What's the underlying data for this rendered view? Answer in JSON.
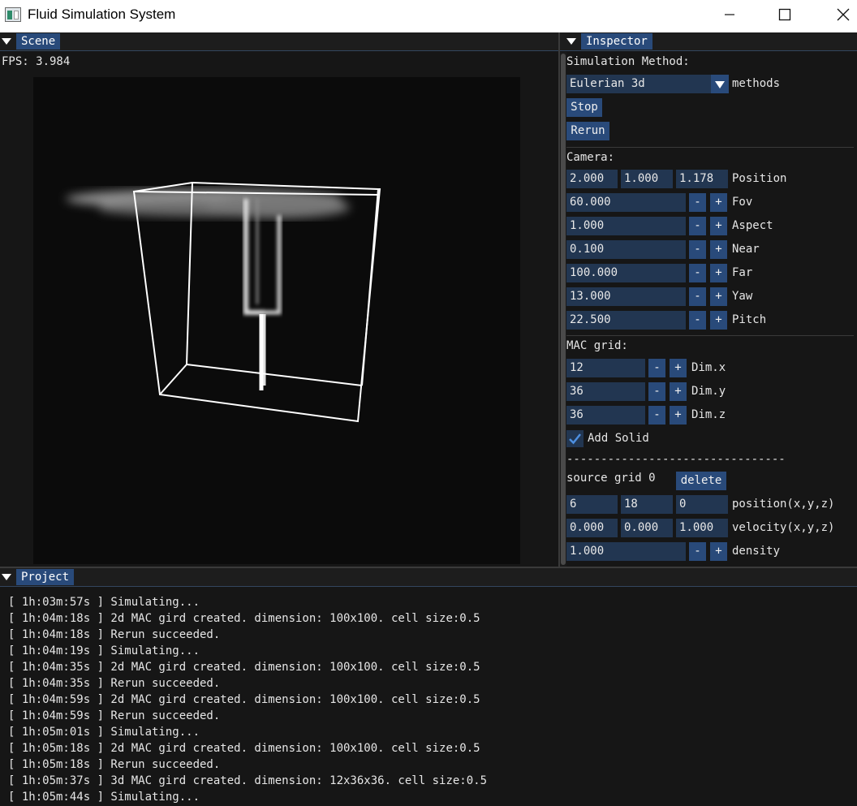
{
  "window": {
    "title": "Fluid Simulation System"
  },
  "scene": {
    "tab_label": "Scene",
    "fps": "FPS: 3.984"
  },
  "inspector": {
    "tab_label": "Inspector",
    "sim_method_label": "Simulation Method:",
    "method_value": "Eulerian 3d",
    "method_suffix": "methods",
    "stop_label": "Stop",
    "rerun_label": "Rerun",
    "camera_label": "Camera:",
    "camera_position": [
      "2.000",
      "1.000",
      "1.178"
    ],
    "position_label": "Position",
    "camera_rows": [
      {
        "value": "60.000",
        "label": "Fov"
      },
      {
        "value": "1.000",
        "label": "Aspect"
      },
      {
        "value": "0.100",
        "label": "Near"
      },
      {
        "value": "100.000",
        "label": "Far"
      },
      {
        "value": "13.000",
        "label": "Yaw"
      },
      {
        "value": "22.500",
        "label": "Pitch"
      }
    ],
    "mac_label": "MAC grid:",
    "mac_rows": [
      {
        "value": "12",
        "label": "Dim.x"
      },
      {
        "value": "36",
        "label": "Dim.y"
      },
      {
        "value": "36",
        "label": "Dim.z"
      }
    ],
    "add_solid_label": "Add Solid",
    "add_solid_checked": true,
    "dash_line": "--------------------------------",
    "source_grid_label": "source grid 0",
    "delete_label": "delete",
    "source_position": [
      "6",
      "18",
      "0"
    ],
    "source_position_label": "position(x,y,z)",
    "source_velocity": [
      "0.000",
      "0.000",
      "1.000"
    ],
    "source_velocity_label": "velocity(x,y,z)",
    "density_value": "1.000",
    "density_label": "density",
    "minus": "-",
    "plus": "+"
  },
  "project": {
    "tab_label": "Project",
    "log": [
      "[ 1h:03m:57s ] Simulating...",
      "[ 1h:04m:18s ] 2d MAC gird created. dimension: 100x100. cell size:0.5",
      "[ 1h:04m:18s ] Rerun succeeded.",
      "[ 1h:04m:19s ] Simulating...",
      "[ 1h:04m:35s ] 2d MAC gird created. dimension: 100x100. cell size:0.5",
      "[ 1h:04m:35s ] Rerun succeeded.",
      "[ 1h:04m:59s ] 2d MAC gird created. dimension: 100x100. cell size:0.5",
      "[ 1h:04m:59s ] Rerun succeeded.",
      "[ 1h:05m:01s ] Simulating...",
      "[ 1h:05m:18s ] 2d MAC gird created. dimension: 100x100. cell size:0.5",
      "[ 1h:05m:18s ] Rerun succeeded.",
      "[ 1h:05m:37s ] 3d MAC gird created. dimension: 12x36x36. cell size:0.5",
      "[ 1h:05m:44s ] Simulating..."
    ]
  },
  "colors": {
    "accent": "#294a7a",
    "field": "#223651",
    "panel": "#161616",
    "checkmark": "#4d8fe0"
  }
}
